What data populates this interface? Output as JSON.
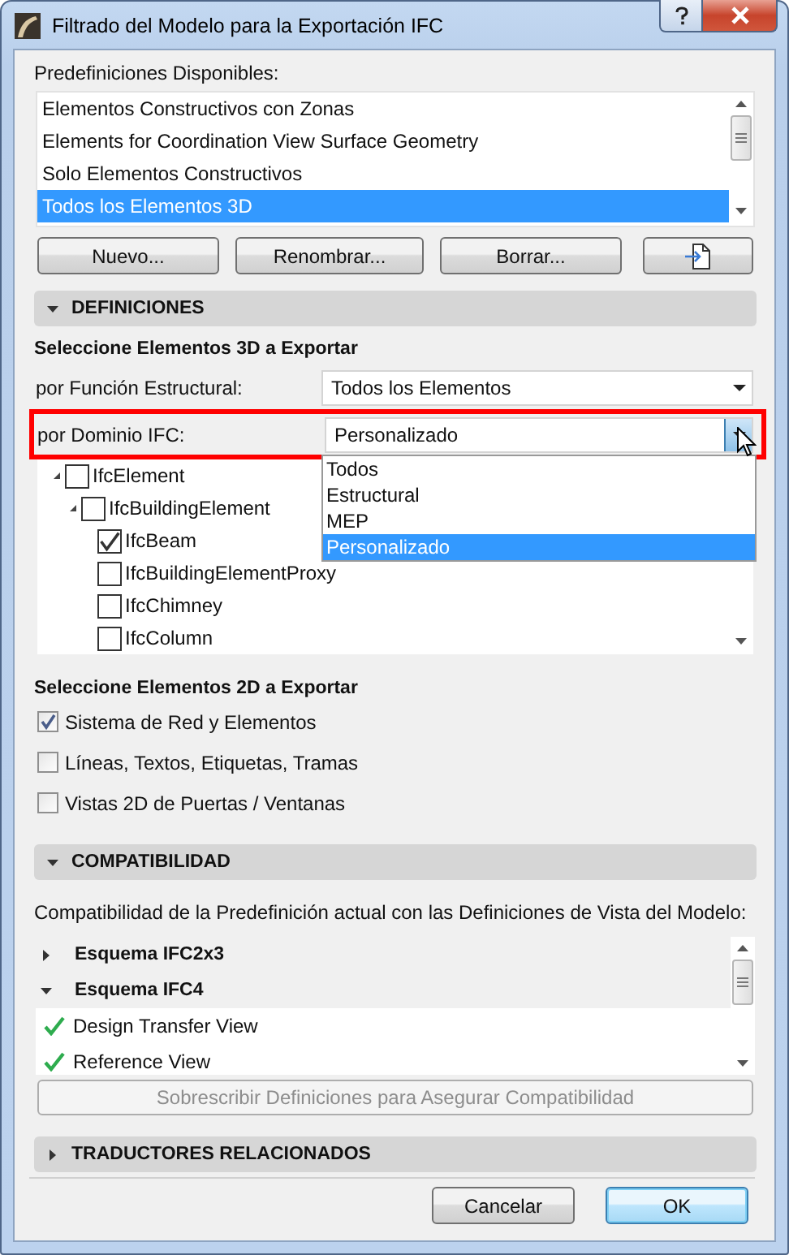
{
  "window": {
    "title": "Filtrado del Modelo para la Exportación IFC"
  },
  "presets": {
    "label": "Predefiniciones Disponibles:",
    "items": [
      {
        "label": "Elementos Constructivos con Zonas",
        "selected": false
      },
      {
        "label": "Elements for Coordination View Surface Geometry",
        "selected": false
      },
      {
        "label": "Solo Elementos Constructivos",
        "selected": false
      },
      {
        "label": "Todos los Elementos 3D",
        "selected": true
      }
    ]
  },
  "preset_buttons": [
    {
      "kind": "text",
      "label": "Nuevo..."
    },
    {
      "kind": "text",
      "label": "Renombrar..."
    },
    {
      "kind": "text",
      "label": "Borrar..."
    },
    {
      "kind": "icon"
    }
  ],
  "definiciones": {
    "title": "DEFINICIONES",
    "expanded": true,
    "heading_3d": "Seleccione Elementos 3D a Exportar",
    "filters": [
      {
        "label": "por Función Estructural:",
        "value": "Todos los Elementos",
        "open": false,
        "highlighted": false
      },
      {
        "label": "por Dominio IFC:",
        "value": "Personalizado",
        "open": true,
        "highlighted": true,
        "options": [
          {
            "label": "Todos",
            "selected": false
          },
          {
            "label": "Estructural",
            "selected": false
          },
          {
            "label": "MEP",
            "selected": false
          },
          {
            "label": "Personalizado",
            "selected": true
          }
        ]
      }
    ],
    "tree": [
      {
        "label": "IfcElement",
        "checked": false,
        "expanded": true,
        "children": [
          {
            "label": "IfcBuildingElement",
            "checked": false,
            "expanded": true,
            "children": [
              {
                "label": "IfcBeam",
                "checked": true
              },
              {
                "label": "IfcBuildingElementProxy",
                "checked": false
              },
              {
                "label": "IfcChimney",
                "checked": false
              },
              {
                "label": "IfcColumn",
                "checked": false
              }
            ]
          }
        ]
      }
    ],
    "heading_2d": "Seleccione Elementos 2D a Exportar",
    "options_2d": [
      {
        "label": "Sistema de Red y Elementos",
        "checked": true
      },
      {
        "label": "Líneas, Textos, Etiquetas, Tramas",
        "checked": false
      },
      {
        "label": "Vistas 2D de Puertas / Ventanas",
        "checked": false
      }
    ]
  },
  "compatibilidad": {
    "title": "COMPATIBILIDAD",
    "expanded": true,
    "description": "Compatibilidad de la Predefinición actual con las Definiciones de Vista del Modelo:",
    "schemas": [
      {
        "label": "Esquema IFC2x3",
        "expanded": false
      },
      {
        "label": "Esquema IFC4",
        "expanded": true,
        "children": [
          {
            "label": "Design Transfer View",
            "compatible": true
          },
          {
            "label": "Reference View",
            "compatible": true
          }
        ]
      }
    ],
    "action_button": {
      "label": "Sobrescribir Definiciones para Asegurar Compatibilidad",
      "disabled": true
    }
  },
  "traductores": {
    "title": "TRADUCTORES RELACIONADOS",
    "expanded": false
  },
  "footer_buttons": [
    {
      "label": "Cancelar",
      "default": false
    },
    {
      "label": "OK",
      "default": true
    }
  ]
}
